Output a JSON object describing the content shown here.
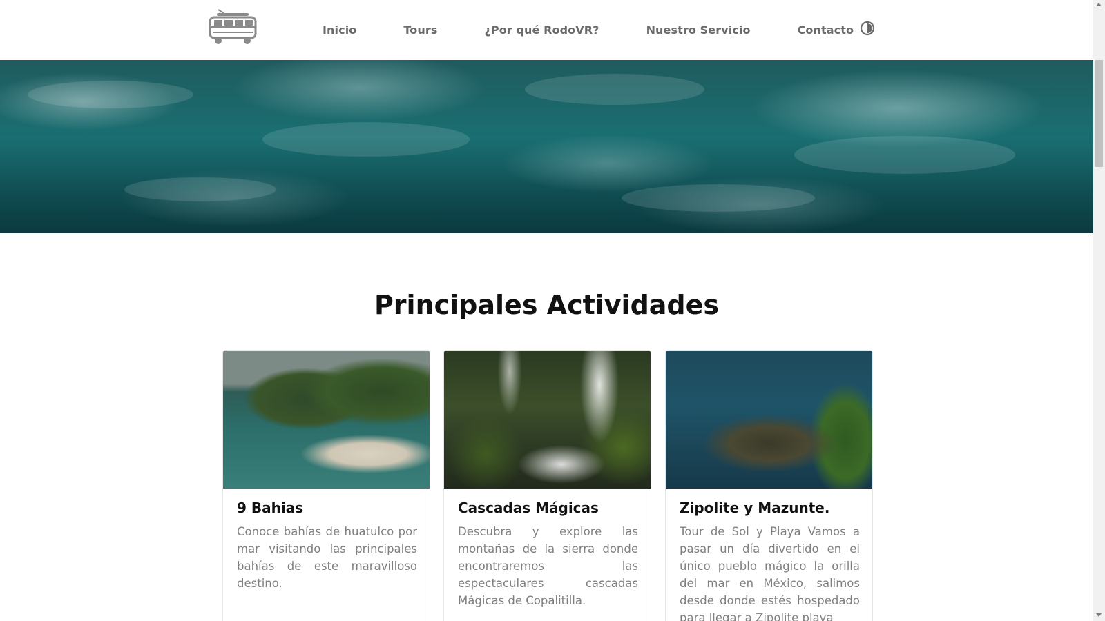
{
  "header": {
    "logo_icon": "van-icon",
    "nav": [
      "Inicio",
      "Tours",
      "¿Por qué RodoVR?",
      "Nuestro Servicio",
      "Contacto"
    ],
    "theme_toggle_icon": "contrast-icon"
  },
  "hero": {
    "image": "ocean-waves"
  },
  "section": {
    "title": "Principales Actividades"
  },
  "cards": [
    {
      "title": "9 Bahias",
      "text": "Conoce bahías de huatulco por mar visitando las principales bahías de este maravilloso destino.",
      "image": "bay-aerial"
    },
    {
      "title": "Cascadas Mágicas",
      "text": "Descubra y explore las montañas de la sierra donde encontraremos las espectaculares cascadas Mágicas de Copalitilla.",
      "image": "waterfall"
    },
    {
      "title": "Zipolite y Mazunte.",
      "text": "Tour de Sol y Playa Vamos a pasar un día divertido en el único pueblo mágico la orilla del mar en México, salimos desde donde estés hospedado para llegar a Zipolite playa",
      "image": "crocodile"
    }
  ],
  "colors": {
    "nav_text": "#6b6b6b",
    "title_text": "#111111",
    "body_text": "#808080"
  }
}
